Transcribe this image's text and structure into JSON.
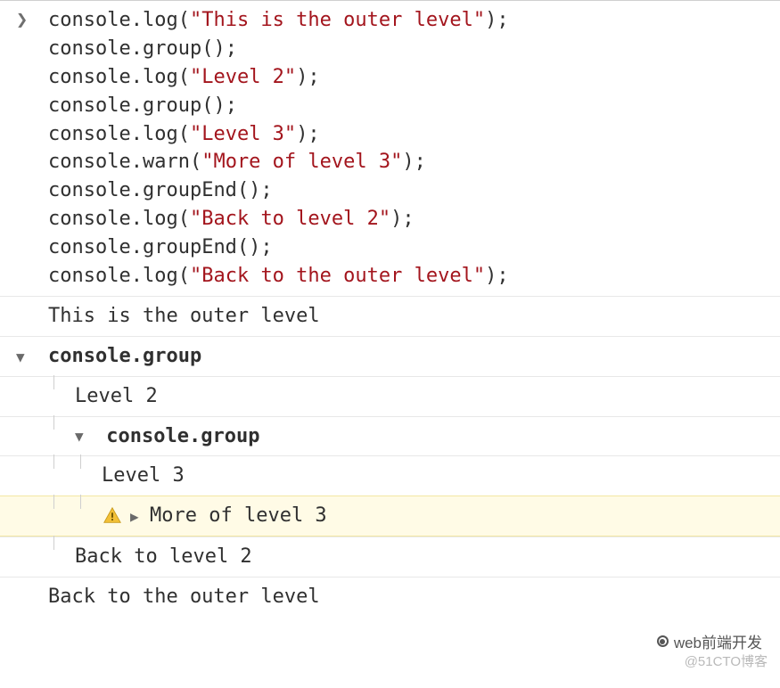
{
  "code": {
    "lines": [
      [
        {
          "t": "console",
          "c": "tok"
        },
        {
          "t": ".",
          "c": "tok"
        },
        {
          "t": "log",
          "c": "tok"
        },
        {
          "t": "(",
          "c": "tok"
        },
        {
          "t": "\"This is the outer level\"",
          "c": "str"
        },
        {
          "t": ");",
          "c": "tok"
        }
      ],
      [
        {
          "t": "console",
          "c": "tok"
        },
        {
          "t": ".",
          "c": "tok"
        },
        {
          "t": "group",
          "c": "tok"
        },
        {
          "t": "();",
          "c": "tok"
        }
      ],
      [
        {
          "t": "console",
          "c": "tok"
        },
        {
          "t": ".",
          "c": "tok"
        },
        {
          "t": "log",
          "c": "tok"
        },
        {
          "t": "(",
          "c": "tok"
        },
        {
          "t": "\"Level 2\"",
          "c": "str"
        },
        {
          "t": ");",
          "c": "tok"
        }
      ],
      [
        {
          "t": "console",
          "c": "tok"
        },
        {
          "t": ".",
          "c": "tok"
        },
        {
          "t": "group",
          "c": "tok"
        },
        {
          "t": "();",
          "c": "tok"
        }
      ],
      [
        {
          "t": "console",
          "c": "tok"
        },
        {
          "t": ".",
          "c": "tok"
        },
        {
          "t": "log",
          "c": "tok"
        },
        {
          "t": "(",
          "c": "tok"
        },
        {
          "t": "\"Level 3\"",
          "c": "str"
        },
        {
          "t": ");",
          "c": "tok"
        }
      ],
      [
        {
          "t": "console",
          "c": "tok"
        },
        {
          "t": ".",
          "c": "tok"
        },
        {
          "t": "warn",
          "c": "tok"
        },
        {
          "t": "(",
          "c": "tok"
        },
        {
          "t": "\"More of level 3\"",
          "c": "str"
        },
        {
          "t": ");",
          "c": "tok"
        }
      ],
      [
        {
          "t": "console",
          "c": "tok"
        },
        {
          "t": ".",
          "c": "tok"
        },
        {
          "t": "groupEnd",
          "c": "tok"
        },
        {
          "t": "();",
          "c": "tok"
        }
      ],
      [
        {
          "t": "console",
          "c": "tok"
        },
        {
          "t": ".",
          "c": "tok"
        },
        {
          "t": "log",
          "c": "tok"
        },
        {
          "t": "(",
          "c": "tok"
        },
        {
          "t": "\"Back to level 2\"",
          "c": "str"
        },
        {
          "t": ");",
          "c": "tok"
        }
      ],
      [
        {
          "t": "console",
          "c": "tok"
        },
        {
          "t": ".",
          "c": "tok"
        },
        {
          "t": "groupEnd",
          "c": "tok"
        },
        {
          "t": "();",
          "c": "tok"
        }
      ],
      [
        {
          "t": "console",
          "c": "tok"
        },
        {
          "t": ".",
          "c": "tok"
        },
        {
          "t": "log",
          "c": "tok"
        },
        {
          "t": "(",
          "c": "tok"
        },
        {
          "t": "\"Back to the outer level\"",
          "c": "str"
        },
        {
          "t": ");",
          "c": "tok"
        }
      ]
    ],
    "prompt": "❯"
  },
  "output": {
    "outer": "This is the outer level",
    "group1_label": "console.group",
    "level2": "Level 2",
    "group2_label": "console.group",
    "level3": "Level 3",
    "warn": "More of level 3",
    "back2": "Back to level 2",
    "backOuter": "Back to the outer level"
  },
  "watermark": {
    "line1": "web前端开发",
    "line2": "@51CTO博客"
  },
  "colors": {
    "string": "#a3151d",
    "warn_bg": "#fffbe6",
    "warn_border": "#f3e7a3",
    "warn_icon_fill": "#f2c037",
    "warn_icon_bang": "#6b5200"
  }
}
